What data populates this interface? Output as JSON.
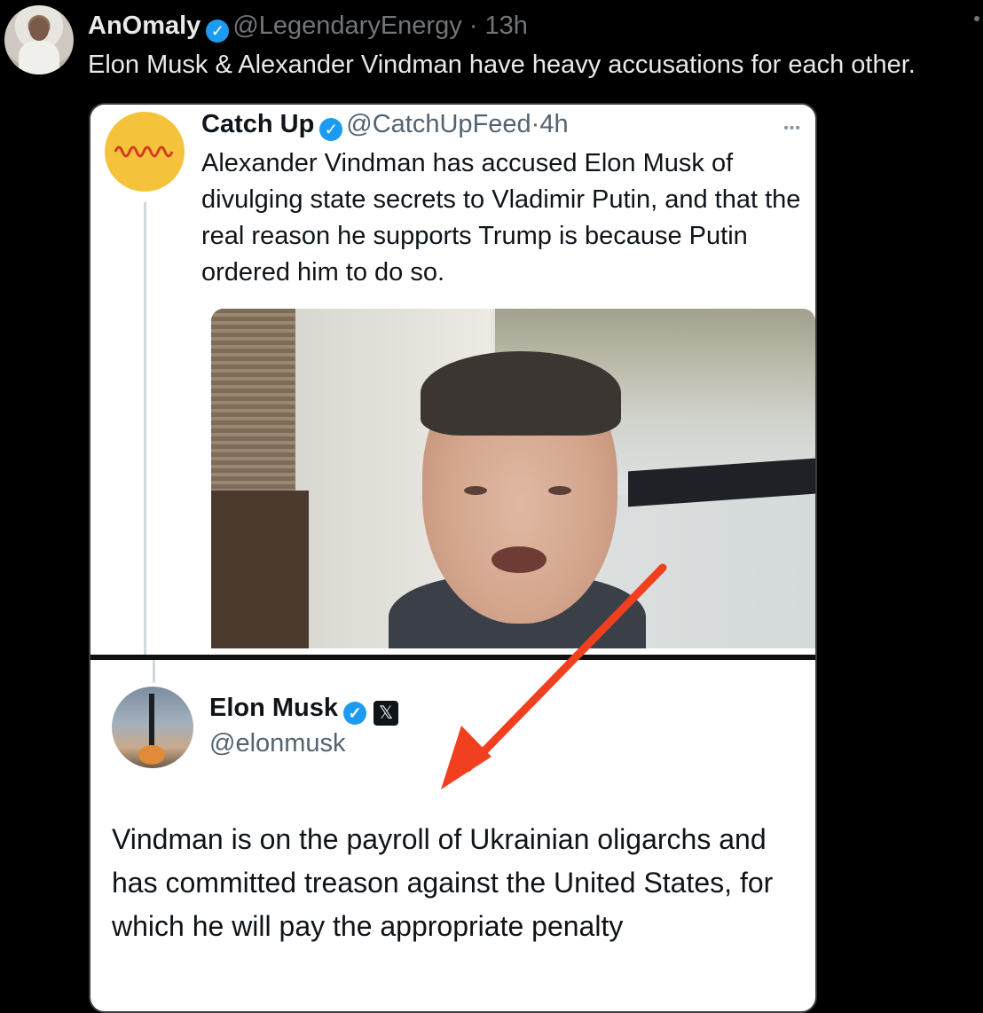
{
  "tweet": {
    "author_name": "AnOmaly",
    "author_handle": "@LegendaryEnergy",
    "separator": "·",
    "time": "13h",
    "text": "Elon Musk & Alexander Vindman have heavy accusations for each other."
  },
  "quoted_image": {
    "catchup": {
      "name": "Catch Up",
      "handle": "@CatchUpFeed",
      "separator": "·",
      "time": "4h",
      "more": "•••",
      "text": "Alexander Vindman has accused Elon Musk of divulging state secrets to Vladimir Putin, and that the real reason he supports Trump is because Putin ordered him to do so."
    },
    "elon": {
      "name": "Elon Musk",
      "x_badge": "𝕏",
      "handle": "@elonmusk",
      "text": "Vindman is on the payroll of Ukrainian oligarchs and has committed treason against the United States, for which he will pay the appropriate penalty"
    }
  },
  "icons": [
    "verified-badge-icon",
    "more-icon",
    "waveform-logo-icon",
    "x-logo-icon",
    "red-arrow-icon"
  ],
  "colors": {
    "verified": "#1d9bf0",
    "arrow": "#f0401f",
    "catchup_avatar": "#f5c33b"
  }
}
